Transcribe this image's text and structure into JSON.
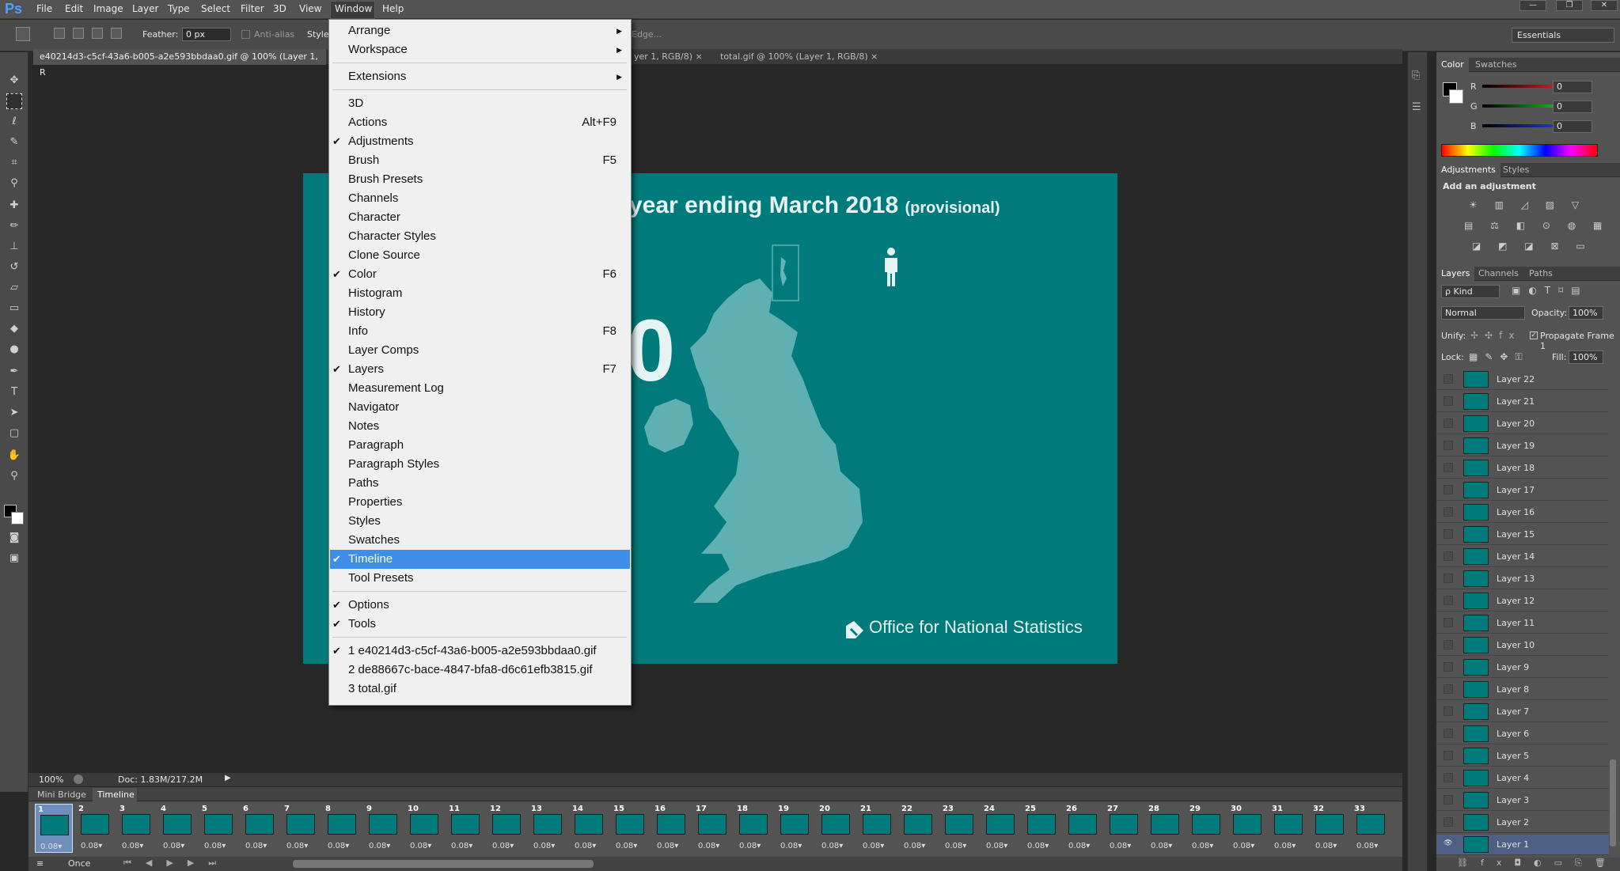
{
  "app": {
    "logo": "Ps"
  },
  "menubar": [
    "File",
    "Edit",
    "Image",
    "Layer",
    "Type",
    "Select",
    "Filter",
    "3D",
    "View",
    "Window",
    "Help"
  ],
  "window_buttons": [
    "—",
    "❐",
    "✕"
  ],
  "options": {
    "feather_label": "Feather:",
    "feather_value": "0 px",
    "antialias_label": "Anti-alias",
    "style_label": "Style:",
    "refine_edge": "Edge...",
    "workspace": "Essentials"
  },
  "tabs": [
    {
      "label": "e40214d3-c5cf-43a6-b005-a2e593bbdaa0.gif @ 100% (Layer 1, R",
      "close": "×"
    },
    {
      "label": "yer 1, RGB/8)",
      "close": "×"
    },
    {
      "label": "total.gif @ 100% (Layer 1, RGB/8)",
      "close": "×"
    }
  ],
  "canvas": {
    "title": "year ending March 2018",
    "title_sub": "(provisional)",
    "big_digit": "0",
    "logo_text_light": "Office for ",
    "logo_text_bold": "National Statistics"
  },
  "status": {
    "zoom": "100%",
    "doc": "Doc: 1.83M/217.2M"
  },
  "timeline": {
    "tabs": [
      "Mini Bridge",
      "Timeline"
    ],
    "active_tab": "Timeline",
    "frames": [
      "1",
      "2",
      "3",
      "4",
      "5",
      "6",
      "7",
      "8",
      "9",
      "10",
      "11",
      "12",
      "13",
      "14",
      "15",
      "16",
      "17",
      "18",
      "19",
      "20",
      "21",
      "22",
      "23",
      "24",
      "25",
      "26",
      "27",
      "28",
      "29",
      "30",
      "31",
      "32",
      "33"
    ],
    "delay": "0.08▾",
    "loop": "Once"
  },
  "color_panel": {
    "tabs": [
      "Color",
      "Swatches"
    ],
    "channels": [
      {
        "label": "R",
        "value": "0",
        "color": "#ff2a2a"
      },
      {
        "label": "G",
        "value": "0",
        "color": "#2adf2a"
      },
      {
        "label": "B",
        "value": "0",
        "color": "#2a4aff"
      }
    ]
  },
  "adjustments_panel": {
    "tabs": [
      "Adjustments",
      "Styles"
    ],
    "title": "Add an adjustment",
    "rows": [
      "☀ ▥ ◿ ▨ ▽",
      "▤ ⚖ ◧ ⊙ ◍ ▦",
      "◪ ◩ ◪ ⊠ ▭"
    ]
  },
  "layers_panel": {
    "tabs": [
      "Layers",
      "Channels",
      "Paths"
    ],
    "kind": "ρ Kind",
    "blend_mode": "Normal",
    "opacity_label": "Opacity:",
    "opacity_value": "100%",
    "unify_label": "Unify:",
    "propagate_label": "Propagate Frame 1",
    "lock_label": "Lock:",
    "fill_label": "Fill:",
    "fill_value": "100%",
    "layers": [
      "Layer 22",
      "Layer 21",
      "Layer 20",
      "Layer 19",
      "Layer 18",
      "Layer 17",
      "Layer 16",
      "Layer 15",
      "Layer 14",
      "Layer 13",
      "Layer 12",
      "Layer 11",
      "Layer 10",
      "Layer 9",
      "Layer 8",
      "Layer 7",
      "Layer 6",
      "Layer 5",
      "Layer 4",
      "Layer 3",
      "Layer 2",
      "Layer 1"
    ],
    "selected_layer": "Layer 1"
  },
  "window_menu": [
    {
      "label": "Arrange",
      "submenu": true
    },
    {
      "label": "Workspace",
      "submenu": true
    },
    {
      "sep": true
    },
    {
      "label": "Extensions",
      "submenu": true
    },
    {
      "sep": true
    },
    {
      "label": "3D"
    },
    {
      "label": "Actions",
      "shortcut": "Alt+F9"
    },
    {
      "label": "Adjustments",
      "checked": true
    },
    {
      "label": "Brush",
      "shortcut": "F5"
    },
    {
      "label": "Brush Presets"
    },
    {
      "label": "Channels"
    },
    {
      "label": "Character"
    },
    {
      "label": "Character Styles"
    },
    {
      "label": "Clone Source"
    },
    {
      "label": "Color",
      "checked": true,
      "shortcut": "F6"
    },
    {
      "label": "Histogram"
    },
    {
      "label": "History"
    },
    {
      "label": "Info",
      "shortcut": "F8"
    },
    {
      "label": "Layer Comps"
    },
    {
      "label": "Layers",
      "checked": true,
      "shortcut": "F7"
    },
    {
      "label": "Measurement Log"
    },
    {
      "label": "Navigator"
    },
    {
      "label": "Notes"
    },
    {
      "label": "Paragraph"
    },
    {
      "label": "Paragraph Styles"
    },
    {
      "label": "Paths"
    },
    {
      "label": "Properties"
    },
    {
      "label": "Styles"
    },
    {
      "label": "Swatches"
    },
    {
      "label": "Timeline",
      "checked": true,
      "highlighted": true
    },
    {
      "label": "Tool Presets"
    },
    {
      "sep": true
    },
    {
      "label": "Options",
      "checked": true
    },
    {
      "label": "Tools",
      "checked": true
    },
    {
      "sep": true
    },
    {
      "label": "1 e40214d3-c5cf-43a6-b005-a2e593bbdaa0.gif",
      "checked": true
    },
    {
      "label": "2 de88667c-bace-4847-bfa8-d6c61efb3815.gif"
    },
    {
      "label": "3 total.gif"
    }
  ]
}
